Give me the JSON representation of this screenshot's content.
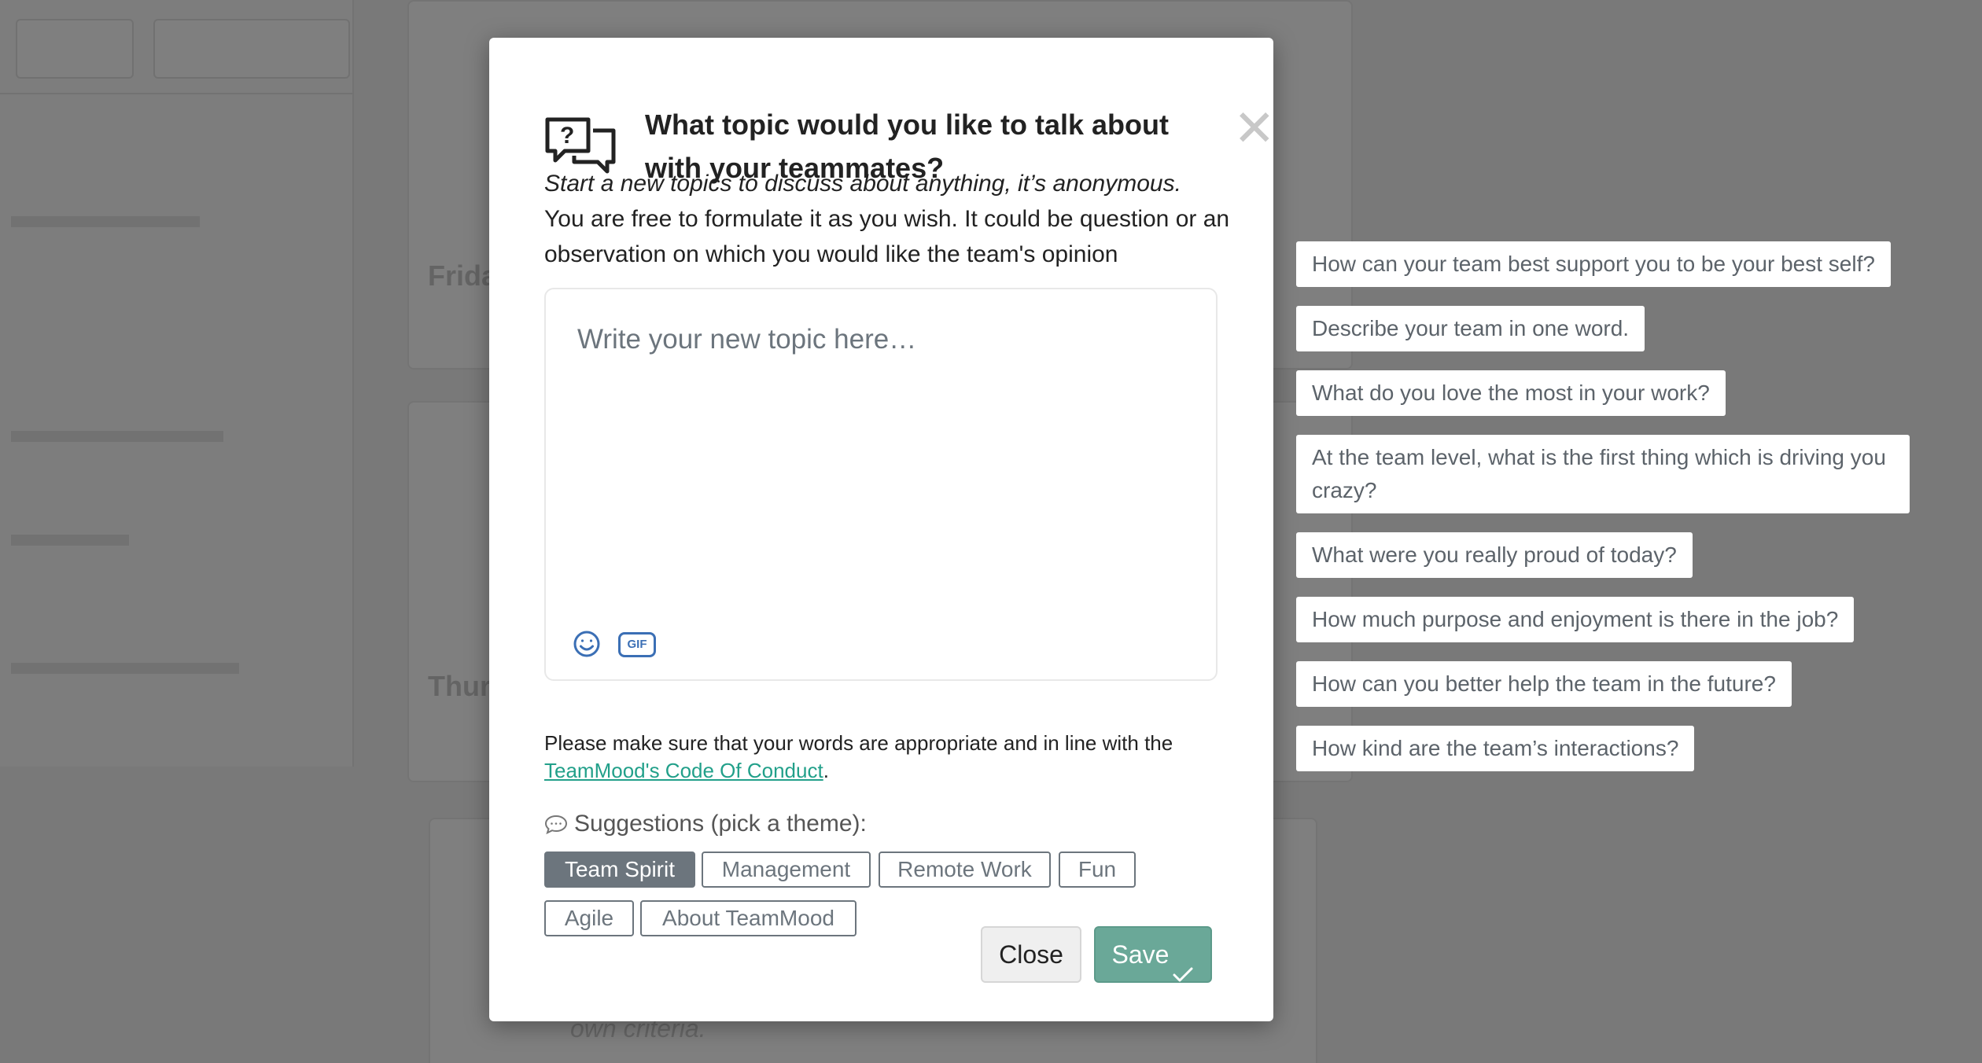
{
  "modal": {
    "title": "What topic would you like to talk about with your teammates?",
    "close_glyph": "✕",
    "intro_italic": "Start a new topics to discuss about anything, it’s anonymous.",
    "intro_text": "You are free to formulate it as you wish. It could be question or an observation on which you would like the team's opinion",
    "topic_placeholder": "Write your new topic here…",
    "gif_label": "GIF",
    "notice_text": "Please make sure that your words are appropriate and in line with the",
    "code_of_conduct_link": "TeamMood's Code Of Conduct",
    "notice_period": ".",
    "suggestions_label": "Suggestions (pick a theme):",
    "themes": [
      {
        "label": "Team Spirit",
        "active": true
      },
      {
        "label": "Management",
        "active": false
      },
      {
        "label": "Remote Work",
        "active": false
      },
      {
        "label": "Fun",
        "active": false
      },
      {
        "label": "Agile",
        "active": false
      },
      {
        "label": "About TeamMood",
        "active": false
      }
    ],
    "close_button": "Close",
    "save_button": "Save"
  },
  "suggestions": [
    "How can your team best support you to be your best self?",
    "Describe your team in one word.",
    "What do you love the most in your work?",
    "At the team level, what is the first thing which is driving you crazy?",
    "What were you really proud of today?",
    "How much purpose and enjoyment is there in the job?",
    "How can you better help the team in the future?",
    "How kind are the team’s interactions?"
  ],
  "background": {
    "day_1": "Frida",
    "day_2": "Thur",
    "footer_italic": "own criteria."
  },
  "colors": {
    "accent": "#6aa898",
    "link": "#22a08a",
    "theme_active": "#6c757d",
    "icon_blue": "#3b6fb5"
  }
}
